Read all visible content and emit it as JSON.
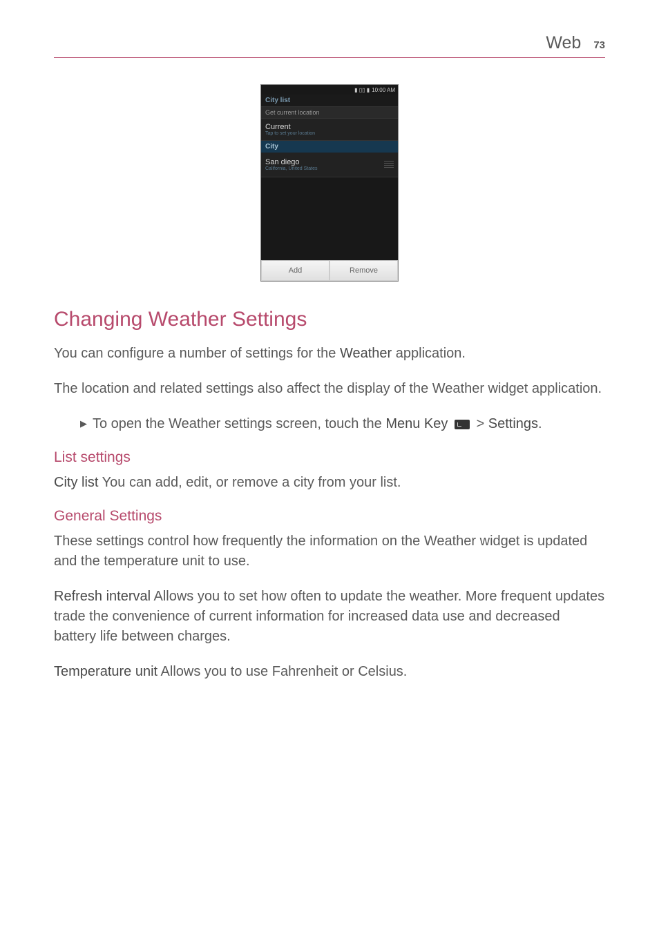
{
  "header": {
    "title": "Web",
    "page_number": "73"
  },
  "screenshot": {
    "status": {
      "time": "10:00 AM"
    },
    "title_bar": "City list",
    "section_get_current": "Get current location",
    "current_row": {
      "title": "Current",
      "sub": "Tap to set your location"
    },
    "city_header": "City",
    "city_row": {
      "title": "San diego",
      "sub": "California, United States"
    },
    "btn_add": "Add",
    "btn_remove": "Remove"
  },
  "h1": "Changing Weather Settings",
  "p1_a": "You can configure a number of settings for the ",
  "p1_b": "Weather",
  "p1_c": " application.",
  "p2": "The location and related settings also affect the display of the Weather widget application.",
  "bullet1_a": "To open the Weather settings screen, touch the ",
  "bullet1_b": "Menu Key",
  "bullet1_c": " > ",
  "bullet1_d": "Settings",
  "bullet1_e": ".",
  "h2_list": "List settings",
  "p3_a": "City list",
  "p3_b": " You can add, edit, or remove a city from your list.",
  "h2_general": "General Settings",
  "p4": "These settings control how frequently the information on the Weather widget is updated and the temperature unit to use.",
  "p5_a": "Refresh interval",
  "p5_b": " Allows you to set how often to update the weather. More frequent updates trade the convenience of current information for increased data use and decreased battery life between charges.",
  "p6_a": "Temperature unit",
  "p6_b": " Allows you to use Fahrenheit or Celsius."
}
